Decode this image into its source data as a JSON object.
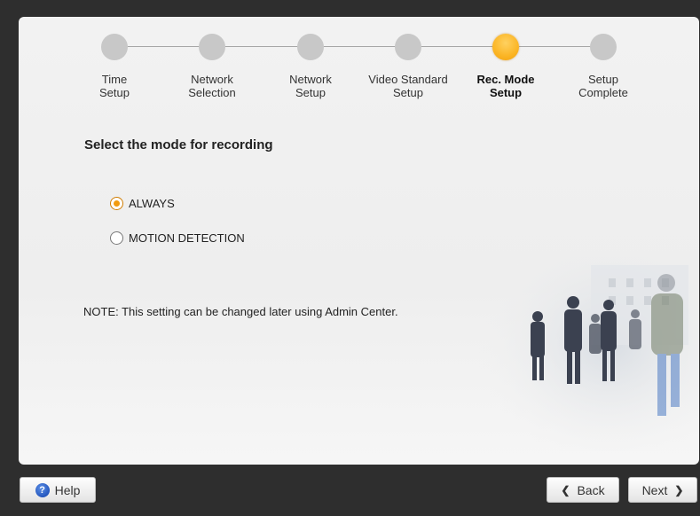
{
  "stepper": {
    "steps": [
      {
        "label": "Time\nSetup",
        "active": false
      },
      {
        "label": "Network\nSelection",
        "active": false
      },
      {
        "label": "Network\nSetup",
        "active": false
      },
      {
        "label": "Video Standard\nSetup",
        "active": false
      },
      {
        "label": "Rec. Mode\nSetup",
        "active": true
      },
      {
        "label": "Setup\nComplete",
        "active": false
      }
    ]
  },
  "main": {
    "heading": "Select the mode for recording",
    "options": [
      {
        "label": "ALWAYS",
        "checked": true
      },
      {
        "label": "MOTION DETECTION",
        "checked": false
      }
    ],
    "note": "NOTE: This setting can be changed later using Admin Center."
  },
  "footer": {
    "help_label": "Help",
    "help_icon": "?",
    "back_label": "Back",
    "next_label": "Next"
  },
  "colors": {
    "active_step": "#fbb525",
    "inactive_step": "#c8c8c8",
    "radio_checked": "#f29b10"
  }
}
